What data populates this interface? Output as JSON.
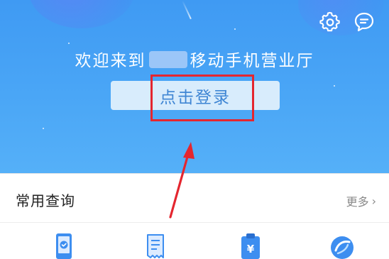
{
  "header": {
    "welcome_prefix": "欢迎来到",
    "welcome_suffix": "移动手机营业厅",
    "login_button": "点击登录",
    "settings_icon": "gear-icon",
    "message_icon": "chat-bubble-icon",
    "background_color": "#4aa6f6"
  },
  "section": {
    "title": "常用查询",
    "more_label": "更多",
    "more_chevron": "›",
    "items": [
      {
        "icon": "phone-check-icon",
        "color": "#3d8ef0"
      },
      {
        "icon": "receipt-icon",
        "color": "#3d8ef0"
      },
      {
        "icon": "yuan-clipboard-icon",
        "color": "#3d8ef0"
      },
      {
        "icon": "flow-circle-icon",
        "color": "#3d8ef0"
      }
    ]
  },
  "annotation": {
    "highlight_color": "#e4262f"
  }
}
